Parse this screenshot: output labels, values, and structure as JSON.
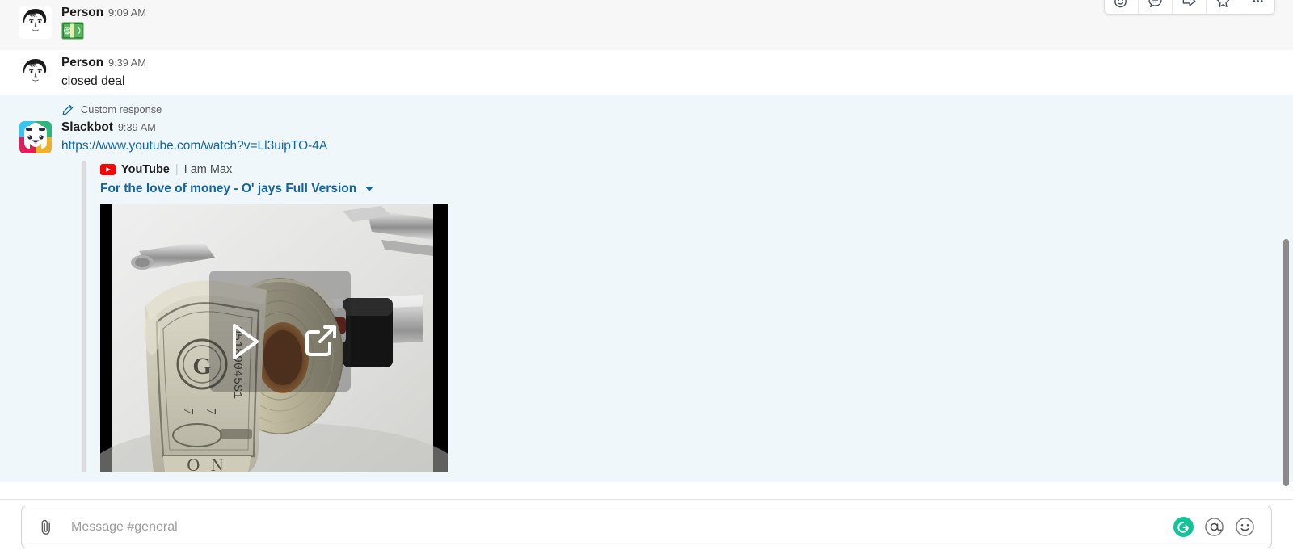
{
  "messages": [
    {
      "id": "msg-person-909",
      "sender": "Person",
      "timestamp": "9:09 AM",
      "text": "",
      "emoji": "💵",
      "avatar": "person-avatar",
      "row_state": "hovered"
    },
    {
      "id": "msg-person-939",
      "sender": "Person",
      "timestamp": "9:39 AM",
      "text": "closed deal",
      "avatar": "person-avatar",
      "row_state": "plain"
    },
    {
      "id": "msg-slackbot-939",
      "meta_label": "Custom response",
      "meta_icon": "pencil-icon",
      "sender": "Slackbot",
      "timestamp": "9:39 AM",
      "link_text": "https://www.youtube.com/watch?v=Ll3uipTO-4A",
      "avatar": "slackbot-avatar",
      "row_state": "highlight"
    }
  ],
  "attachment": {
    "service_icon": "youtube-icon",
    "service_name": "YouTube",
    "divider": "|",
    "author": "I am Max",
    "title": "For the love of money - O' jays Full Version",
    "expand_icon": "chevron-down-icon",
    "thumbnail_alt": "roll of dollar bills on a toilet paper holder",
    "play_icon": "play-icon",
    "external_icon": "external-link-icon"
  },
  "hover_toolbar": {
    "buttons": [
      {
        "name": "add-reaction-button",
        "icon": "emoji-plus-icon",
        "title": "Add reaction"
      },
      {
        "name": "reply-in-thread-button",
        "icon": "thread-comment-icon",
        "title": "Reply in thread"
      },
      {
        "name": "share-message-button",
        "icon": "forward-arrow-icon",
        "title": "Share message"
      },
      {
        "name": "save-message-button",
        "icon": "star-icon",
        "title": "Save for later"
      },
      {
        "name": "more-actions-button",
        "icon": "ellipsis-icon",
        "title": "More actions"
      }
    ]
  },
  "composer": {
    "placeholder": "Message #general",
    "value": "",
    "attach_icon": "paperclip-icon",
    "actions": [
      {
        "name": "grammarly-button",
        "icon": "grammarly-icon",
        "label": "G"
      },
      {
        "name": "mention-button",
        "icon": "at-mention-icon"
      },
      {
        "name": "emoji-button",
        "icon": "smiley-icon"
      }
    ]
  },
  "colors": {
    "link": "#1264a3",
    "highlight_row": "#eff7fb",
    "hover_row": "#f7f7f7",
    "youtube_red": "#ff0000",
    "grammarly_green": "#15c39a",
    "text_primary": "#1d1c1d",
    "text_secondary": "#616061"
  },
  "scrollbar": {
    "name": "message-list-scrollbar"
  }
}
